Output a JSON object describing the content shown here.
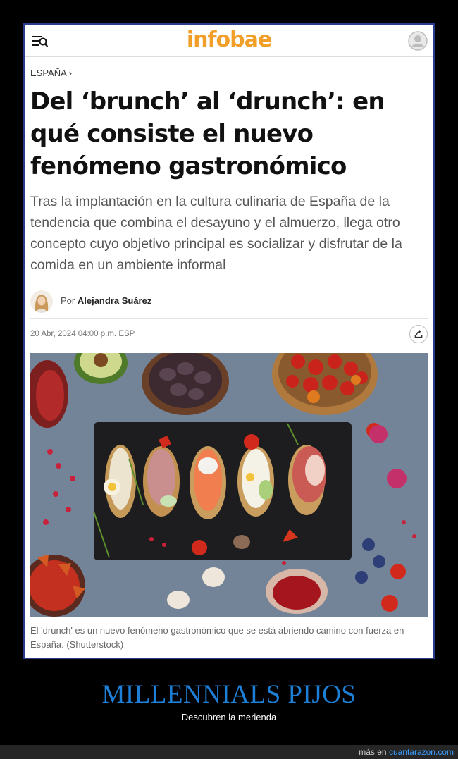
{
  "site": {
    "logo_text": "infobae",
    "brand_color": "#f29f2a",
    "menu_icon": "menu-search-icon",
    "user_icon": "user-avatar-icon"
  },
  "article": {
    "section": "ESPAÑA",
    "headline": "Del ‘brunch’ al ‘drunch’: en qué consiste el nuevo fenómeno gastronómico",
    "subhead": "Tras la implantación en la cultura culinaria de España de la tendencia que combina el desayuno y el almuerzo, llega otro concepto cuyo objetivo principal es socializar y disfrutar de la comida en un ambiente informal",
    "author_prefix": "Por",
    "author_name": "Alejandra Suárez",
    "date": "20 Abr, 2024 04:00 p.m. ESP",
    "share_icon": "share-icon",
    "image_description_icon": "food-photo",
    "caption": "El 'drunch' es un nuevo fenómeno gastronómico que se está abriendo camino con fuerza en España. (Shutterstock)"
  },
  "meme": {
    "title": "MILLENNIALS PIJOS",
    "subtitle": "Descubren la merienda",
    "title_color": "#1e7fd6"
  },
  "footer": {
    "prefix": "más en",
    "link": "cuantarazon.com",
    "link_color": "#3b9cff"
  }
}
